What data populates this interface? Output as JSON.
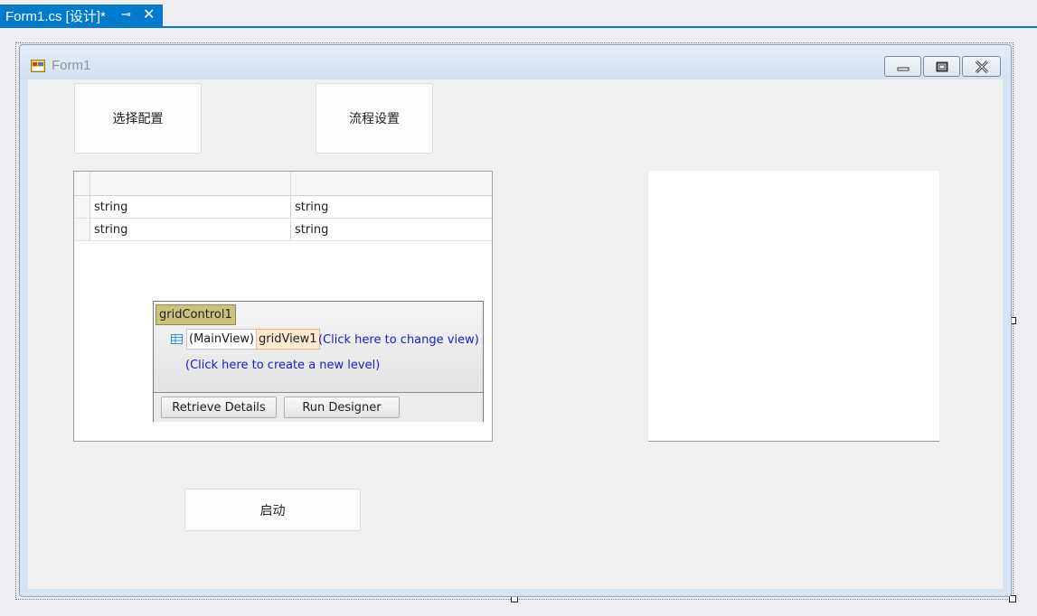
{
  "tab": {
    "title": "Form1.cs [设计]*",
    "pin_glyph": "⊸",
    "close_glyph": "✕"
  },
  "form": {
    "title": "Form1"
  },
  "buttons": {
    "select_config": "选择配置",
    "flow_settings": "流程设置",
    "start": "启动"
  },
  "grid": {
    "rows": [
      [
        "string",
        "string"
      ],
      [
        "string",
        "string"
      ]
    ]
  },
  "smart_panel": {
    "control_name": "gridControl1",
    "main_view": "(MainView)",
    "view_name": "gridView1",
    "change_view_link": "(Click here to change view)",
    "new_level_link": "(Click here to create a new level)",
    "retrieve_details_button": "Retrieve Details",
    "run_designer_button": "Run Designer"
  },
  "colors": {
    "accent": "#007acc",
    "control_name_highlight": "#c9c47a",
    "view_tag_highlight": "#fde9cf",
    "link": "#1a1acc"
  }
}
